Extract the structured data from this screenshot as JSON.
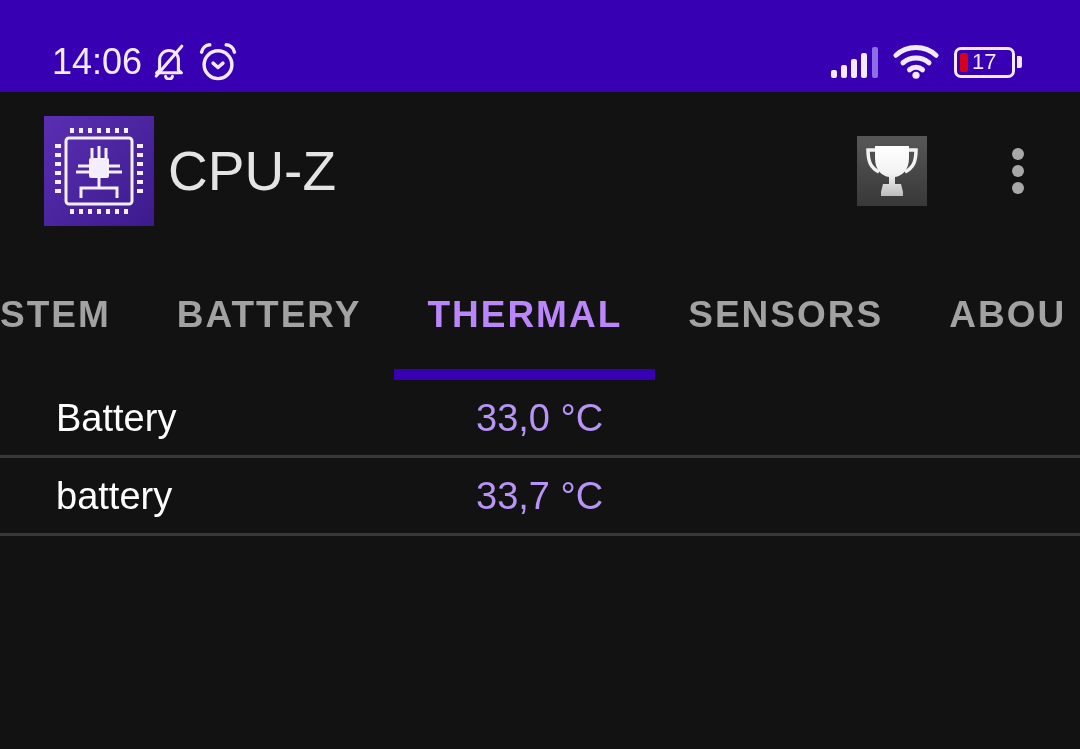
{
  "status_bar": {
    "time": "14:06",
    "battery_percent": "17"
  },
  "app_bar": {
    "title": "CPU-Z"
  },
  "tabs": [
    {
      "label": "STEM",
      "selected": false
    },
    {
      "label": "BATTERY",
      "selected": false
    },
    {
      "label": "THERMAL",
      "selected": true
    },
    {
      "label": "SENSORS",
      "selected": false
    },
    {
      "label": "ABOU",
      "selected": false
    }
  ],
  "thermal_rows": [
    {
      "name": "Battery",
      "value": "33,0 °C"
    },
    {
      "name": "battery",
      "value": "33,7 °C"
    }
  ]
}
